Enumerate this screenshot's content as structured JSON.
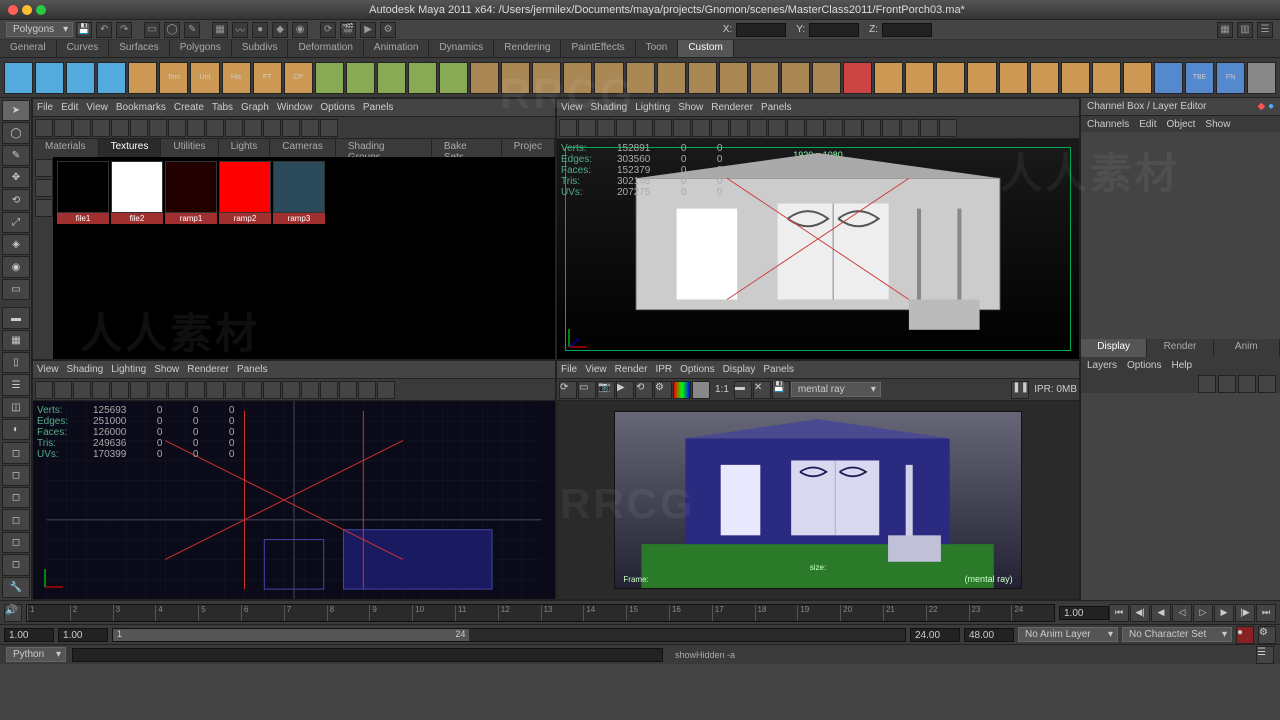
{
  "title": "Autodesk Maya 2011 x64: /Users/jermilex/Documents/maya/projects/Gnomon/scenes/MasterClass2011/FrontPorch03.ma*",
  "mode_selector": "Polygons",
  "coord_labels": {
    "x": "X:",
    "y": "Y:",
    "z": "Z:"
  },
  "shelf_tabs": [
    "General",
    "Curves",
    "Surfaces",
    "Polygons",
    "Subdivs",
    "Deformation",
    "Animation",
    "Dynamics",
    "Rendering",
    "PaintEffects",
    "Toon",
    "Custom"
  ],
  "shelf_tab_active": 11,
  "shelf_icons": [
    "",
    "",
    "",
    "",
    "",
    "Tem",
    "Unt",
    "His",
    "FT",
    "CP",
    "",
    "",
    "",
    "",
    "",
    "",
    "",
    "",
    "",
    "",
    "",
    "",
    "",
    "",
    "",
    "",
    "",
    "",
    "",
    "",
    "",
    "",
    "",
    "",
    "",
    "",
    "",
    "",
    "TBE",
    "FN",
    ""
  ],
  "hypershade": {
    "menus": [
      "File",
      "Edit",
      "View",
      "Bookmarks",
      "Create",
      "Tabs",
      "Graph",
      "Window",
      "Options",
      "Panels"
    ],
    "tabs": [
      "Materials",
      "Textures",
      "Utilities",
      "Lights",
      "Cameras",
      "Shading Groups",
      "Bake Sets",
      "Projec"
    ],
    "tab_active": 1,
    "swatches": [
      {
        "name": "file1",
        "bg": "#000"
      },
      {
        "name": "file2",
        "bg": "#fff"
      },
      {
        "name": "ramp1",
        "bg": "#200"
      },
      {
        "name": "ramp2",
        "bg": "#f00"
      },
      {
        "name": "ramp3",
        "bg": "#2a4a5a"
      }
    ]
  },
  "persp_panel": {
    "menus": [
      "View",
      "Shading",
      "Lighting",
      "Show",
      "Renderer",
      "Panels"
    ],
    "resolution_gate": "1920 x 1080",
    "hud": {
      "Verts": "152891",
      "Edges": "303560",
      "Faces": "152379",
      "Tris": "302146",
      "UVs": "207275"
    },
    "hud_cols": [
      "0",
      "0"
    ]
  },
  "ortho_panel": {
    "menus": [
      "View",
      "Shading",
      "Lighting",
      "Show",
      "Renderer",
      "Panels"
    ],
    "hud": {
      "Verts": "125693",
      "Edges": "251000",
      "Faces": "126000",
      "Tris": "249636",
      "UVs": "170399"
    },
    "hud_cols": [
      "0",
      "0",
      "0"
    ]
  },
  "renderview": {
    "menus": [
      "File",
      "View",
      "Render",
      "IPR",
      "Options",
      "Display",
      "Panels"
    ],
    "zoom": "1:1",
    "renderer": "mental ray",
    "ipr_label": "IPR: 0MB",
    "overlay_renderer": "(mental ray)",
    "overlay_size": "size:",
    "overlay_frame": "Frame:"
  },
  "channel_box": {
    "title": "Channel Box / Layer Editor",
    "menu": [
      "Channels",
      "Edit",
      "Object",
      "Show"
    ],
    "tabs": [
      "Display",
      "Render",
      "Anim"
    ],
    "tab_active": 0,
    "layer_menu": [
      "Layers",
      "Options",
      "Help"
    ]
  },
  "time": {
    "start": "1.00",
    "end": "1.00",
    "range_start": "1",
    "range_end": "24",
    "pb_start": "24.00",
    "pb_end": "48.00",
    "ticks": [
      "1",
      "2",
      "3",
      "4",
      "5",
      "6",
      "7",
      "8",
      "9",
      "10",
      "11",
      "12",
      "13",
      "14",
      "15",
      "16",
      "17",
      "18",
      "19",
      "20",
      "21",
      "22",
      "23",
      "24"
    ],
    "cur": "1.00",
    "anim_layer": "No Anim Layer",
    "char_set": "No Character Set"
  },
  "cmdline": {
    "lang": "Python"
  },
  "helpline": "showHidden -a",
  "watermark": "人人素材 RRCG"
}
